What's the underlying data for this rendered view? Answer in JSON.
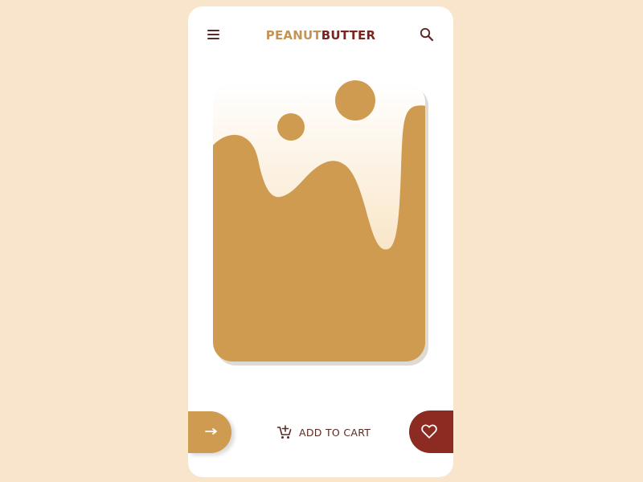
{
  "header": {
    "brand_part1": "PEANUT",
    "brand_part2": "BUTTER",
    "menu_icon": "hamburger-menu-icon",
    "search_icon": "search-icon"
  },
  "product": {
    "image": "peanut-butter-splash-illustration"
  },
  "actions": {
    "next_icon": "arrow-right-icon",
    "add_to_cart_label": "ADD TO CART",
    "cart_icon": "add-to-cart-icon",
    "favorite_icon": "heart-icon"
  },
  "colors": {
    "background": "#f8e5cc",
    "card": "#ffffff",
    "brand_light": "#c49457",
    "brand_dark": "#7a2620",
    "peanut": "#ce9b50",
    "favorite": "#8c2b22",
    "text": "#5a2a24"
  }
}
